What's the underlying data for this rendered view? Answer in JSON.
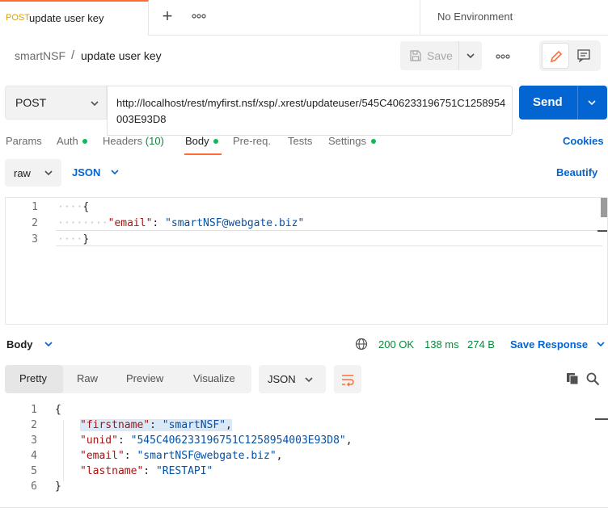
{
  "tabs": {
    "active": {
      "method": "POST",
      "title": "update user key"
    },
    "environment": "No Environment"
  },
  "breadcrumb": {
    "workspace": "smartNSF",
    "separator": "/",
    "request": "update user key"
  },
  "toolbar": {
    "save_label": "Save"
  },
  "request": {
    "method": "POST",
    "url": "http://localhost/rest/myfirst.nsf/xsp/.xrest/updateuser/545C406233196751C1258954003E93D8",
    "send_label": "Send"
  },
  "request_tabs": {
    "params": "Params",
    "auth": "Auth",
    "headers": "Headers",
    "headers_count": "(10)",
    "body": "Body",
    "prereq": "Pre-req.",
    "tests": "Tests",
    "settings": "Settings",
    "cookies": "Cookies"
  },
  "body_options": {
    "mode": "raw",
    "language": "JSON",
    "beautify": "Beautify"
  },
  "request_body": {
    "line_numbers": [
      "1",
      "2",
      "3"
    ],
    "open_brace": "{",
    "key": "\"email\"",
    "colon": ": ",
    "value": "\"smartNSF@webgate.biz\"",
    "close_brace": "}"
  },
  "response": {
    "section_label": "Body",
    "status": "200 OK",
    "time": "138 ms",
    "size": "274 B",
    "save_label": "Save Response",
    "view_tabs": [
      "Pretty",
      "Raw",
      "Preview",
      "Visualize"
    ],
    "format": "JSON",
    "line_numbers": [
      "1",
      "2",
      "3",
      "4",
      "5",
      "6"
    ],
    "open_brace": "{",
    "close_brace": "}",
    "fields": [
      {
        "key": "\"firstname\"",
        "value": "\"smartNSF\"",
        "comma": ","
      },
      {
        "key": "\"unid\"",
        "value": "\"545C406233196751C1258954003E93D8\"",
        "comma": ","
      },
      {
        "key": "\"email\"",
        "value": "\"smartNSF@webgate.biz\"",
        "comma": ","
      },
      {
        "key": "\"lastname\"",
        "value": "\"RESTAPI\"",
        "comma": ""
      }
    ]
  },
  "colors": {
    "accent": "#ff6c37",
    "primary": "#0265d2",
    "success": "#0a8a3b"
  }
}
